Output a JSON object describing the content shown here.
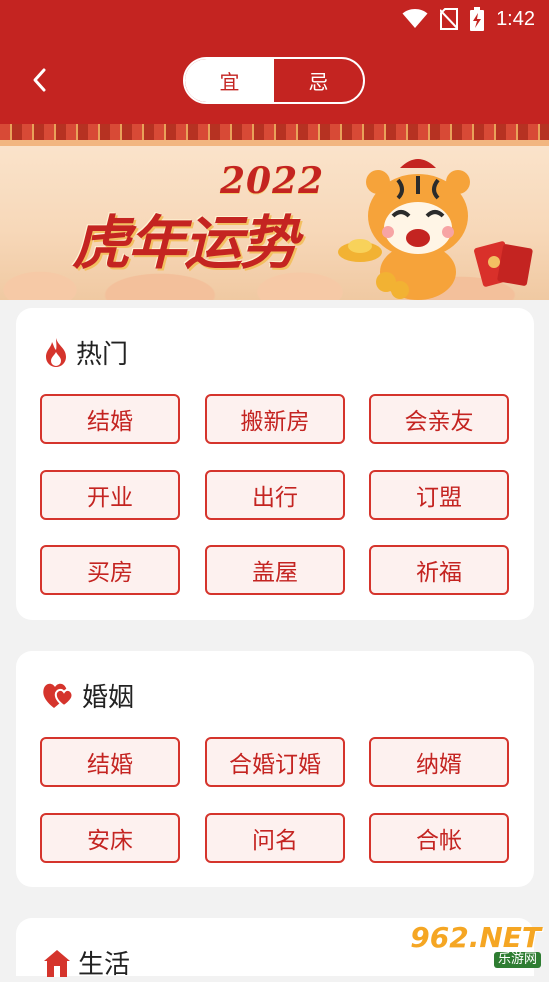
{
  "colors": {
    "primary": "#c42421",
    "tag_border": "#d5342c",
    "tag_bg": "#fdf1ef",
    "page_bg": "#f2f2f2"
  },
  "status_bar": {
    "time": "1:42",
    "icons": [
      "wifi-icon",
      "no-sim-icon",
      "battery-charging-icon"
    ]
  },
  "nav": {
    "back_icon": "chevron-left-icon",
    "tabs": [
      {
        "label": "宜",
        "active": true
      },
      {
        "label": "忌",
        "active": false
      }
    ]
  },
  "banner": {
    "year": "2022",
    "title": "虎年运势"
  },
  "sections": {
    "hot": {
      "title": "热门",
      "icon": "flame-icon",
      "items": [
        "结婚",
        "搬新房",
        "会亲友",
        "开业",
        "出行",
        "订盟",
        "买房",
        "盖屋",
        "祈福"
      ]
    },
    "marriage": {
      "title": "婚姻",
      "icon": "hearts-icon",
      "items": [
        "结婚",
        "合婚订婚",
        "纳婿",
        "安床",
        "问名",
        "合帐"
      ]
    },
    "life": {
      "title": "生活",
      "icon": "house-icon"
    }
  },
  "watermark": {
    "brand": "962.NET",
    "sub": "乐游网"
  }
}
